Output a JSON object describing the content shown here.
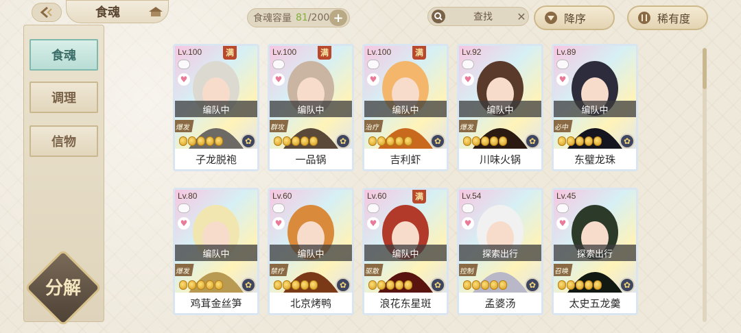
{
  "header": {
    "title": "食魂",
    "capacity_label": "食魂容量",
    "capacity_current": "81",
    "capacity_max": "/200",
    "search_label": "查找",
    "sort_order_label": "降序",
    "sort_rarity_label": "稀有度"
  },
  "sidebar": {
    "items": [
      {
        "label": "食魂",
        "active": true
      },
      {
        "label": "调理",
        "active": false
      },
      {
        "label": "信物",
        "active": false
      }
    ],
    "decompose_label": "分解"
  },
  "cards": [
    {
      "level": "Lv.100",
      "max": "满",
      "status": "编队中",
      "role": "爆发",
      "name": "子龙脱袍",
      "stars": 5
    },
    {
      "level": "Lv.100",
      "max": "满",
      "status": "编队中",
      "role": "群攻",
      "name": "一品锅",
      "stars": 5
    },
    {
      "level": "Lv.100",
      "max": "满",
      "status": "编队中",
      "role": "治疗",
      "name": "吉利虾",
      "stars": 5
    },
    {
      "level": "Lv.92",
      "max": "",
      "status": "编队中",
      "role": "爆发",
      "name": "川味火锅",
      "stars": 5
    },
    {
      "level": "Lv.89",
      "max": "",
      "status": "编队中",
      "role": "必中",
      "name": "东璧龙珠",
      "stars": 5
    },
    {
      "level": "Lv.80",
      "max": "",
      "status": "编队中",
      "role": "爆发",
      "name": "鸡茸金丝笋",
      "stars": 5
    },
    {
      "level": "Lv.60",
      "max": "",
      "status": "编队中",
      "role": "禁疗",
      "name": "北京烤鸭",
      "stars": 5
    },
    {
      "level": "Lv.60",
      "max": "满",
      "status": "编队中",
      "role": "驱散",
      "name": "浪花东星斑",
      "stars": 5
    },
    {
      "level": "Lv.54",
      "max": "",
      "status": "探索出行",
      "role": "控制",
      "name": "孟婆汤",
      "stars": 5
    },
    {
      "level": "Lv.45",
      "max": "",
      "status": "探索出行",
      "role": "召唤",
      "name": "太史五龙羹",
      "stars": 5
    }
  ],
  "colors": {
    "background": "#efe9dc",
    "accent_active": "#b8ddd5",
    "capacity_current": "#7fae3a",
    "max_badge": "#b8492c"
  }
}
